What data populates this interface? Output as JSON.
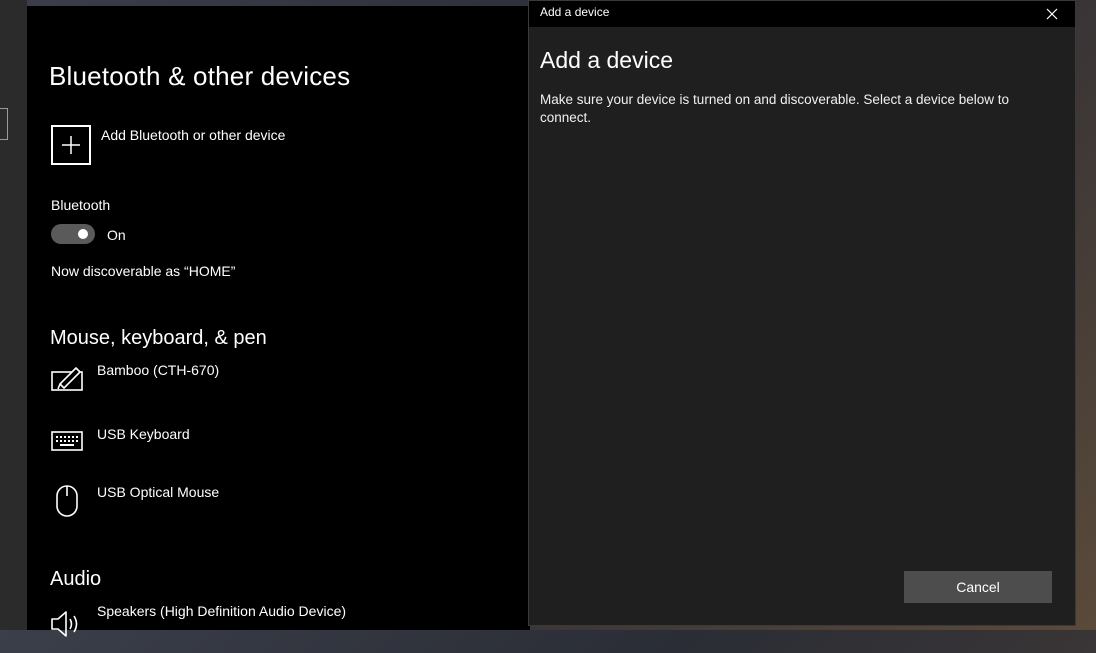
{
  "settings": {
    "title": "Bluetooth & other devices",
    "add_device_label": "Add Bluetooth or other device",
    "bluetooth_heading": "Bluetooth",
    "bluetooth_state": "On",
    "discoverable_text": "Now discoverable as “HOME”",
    "sections": {
      "input": {
        "heading": "Mouse, keyboard, & pen",
        "devices": [
          {
            "name": "Bamboo (CTH-670)",
            "icon": "pen-tablet-icon"
          },
          {
            "name": "USB Keyboard",
            "icon": "keyboard-icon"
          },
          {
            "name": "USB Optical Mouse",
            "icon": "mouse-icon"
          }
        ]
      },
      "audio": {
        "heading": "Audio",
        "devices": [
          {
            "name": "Speakers (High Definition Audio Device)",
            "icon": "speaker-icon"
          }
        ]
      }
    }
  },
  "dialog": {
    "window_title": "Add a device",
    "heading": "Add a device",
    "description": "Make sure your device is turned on and discoverable. Select a device below to connect.",
    "cancel_label": "Cancel"
  },
  "colors": {
    "settings_bg": "#000000",
    "dialog_bg": "#1f1f1f",
    "button_bg": "#4d4d4d",
    "toggle_bg": "#5a5a5a"
  }
}
